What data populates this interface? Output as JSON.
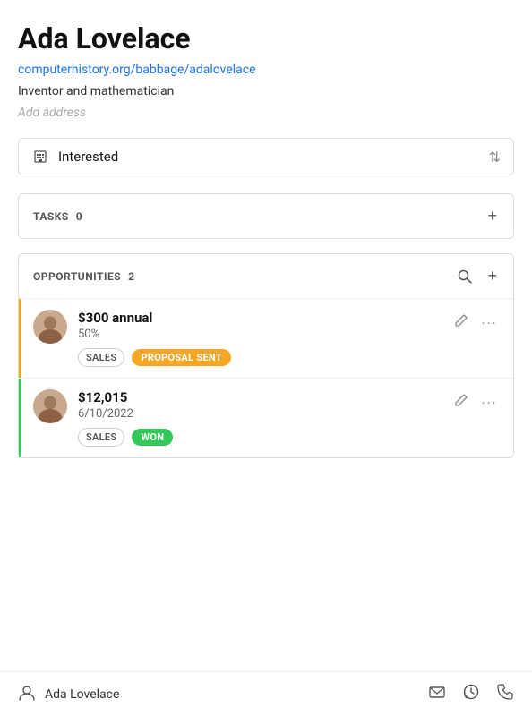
{
  "header": {
    "title": "Ada Lovelace",
    "website": "computerhistory.org/babbage/adalovelace",
    "subtitle": "Inventor and mathematician",
    "add_address_placeholder": "Add address"
  },
  "status": {
    "label": "Interested",
    "icon": "building-icon"
  },
  "tasks_section": {
    "title": "TASKS",
    "count": "0",
    "add_label": "+"
  },
  "opportunities_section": {
    "title": "OPPORTUNITIES",
    "count": "2",
    "search_label": "search",
    "add_label": "+"
  },
  "opportunities": [
    {
      "amount": "$300 annual",
      "detail": "50%",
      "tag": "SALES",
      "status": "PROPOSAL SENT",
      "status_class": "tag-proposal",
      "bar_class": "yellow-bar"
    },
    {
      "amount": "$12,015",
      "detail": "6/10/2022",
      "tag": "SALES",
      "status": "WON",
      "status_class": "tag-won",
      "bar_class": "green-bar"
    }
  ],
  "footer": {
    "name": "Ada Lovelace"
  }
}
